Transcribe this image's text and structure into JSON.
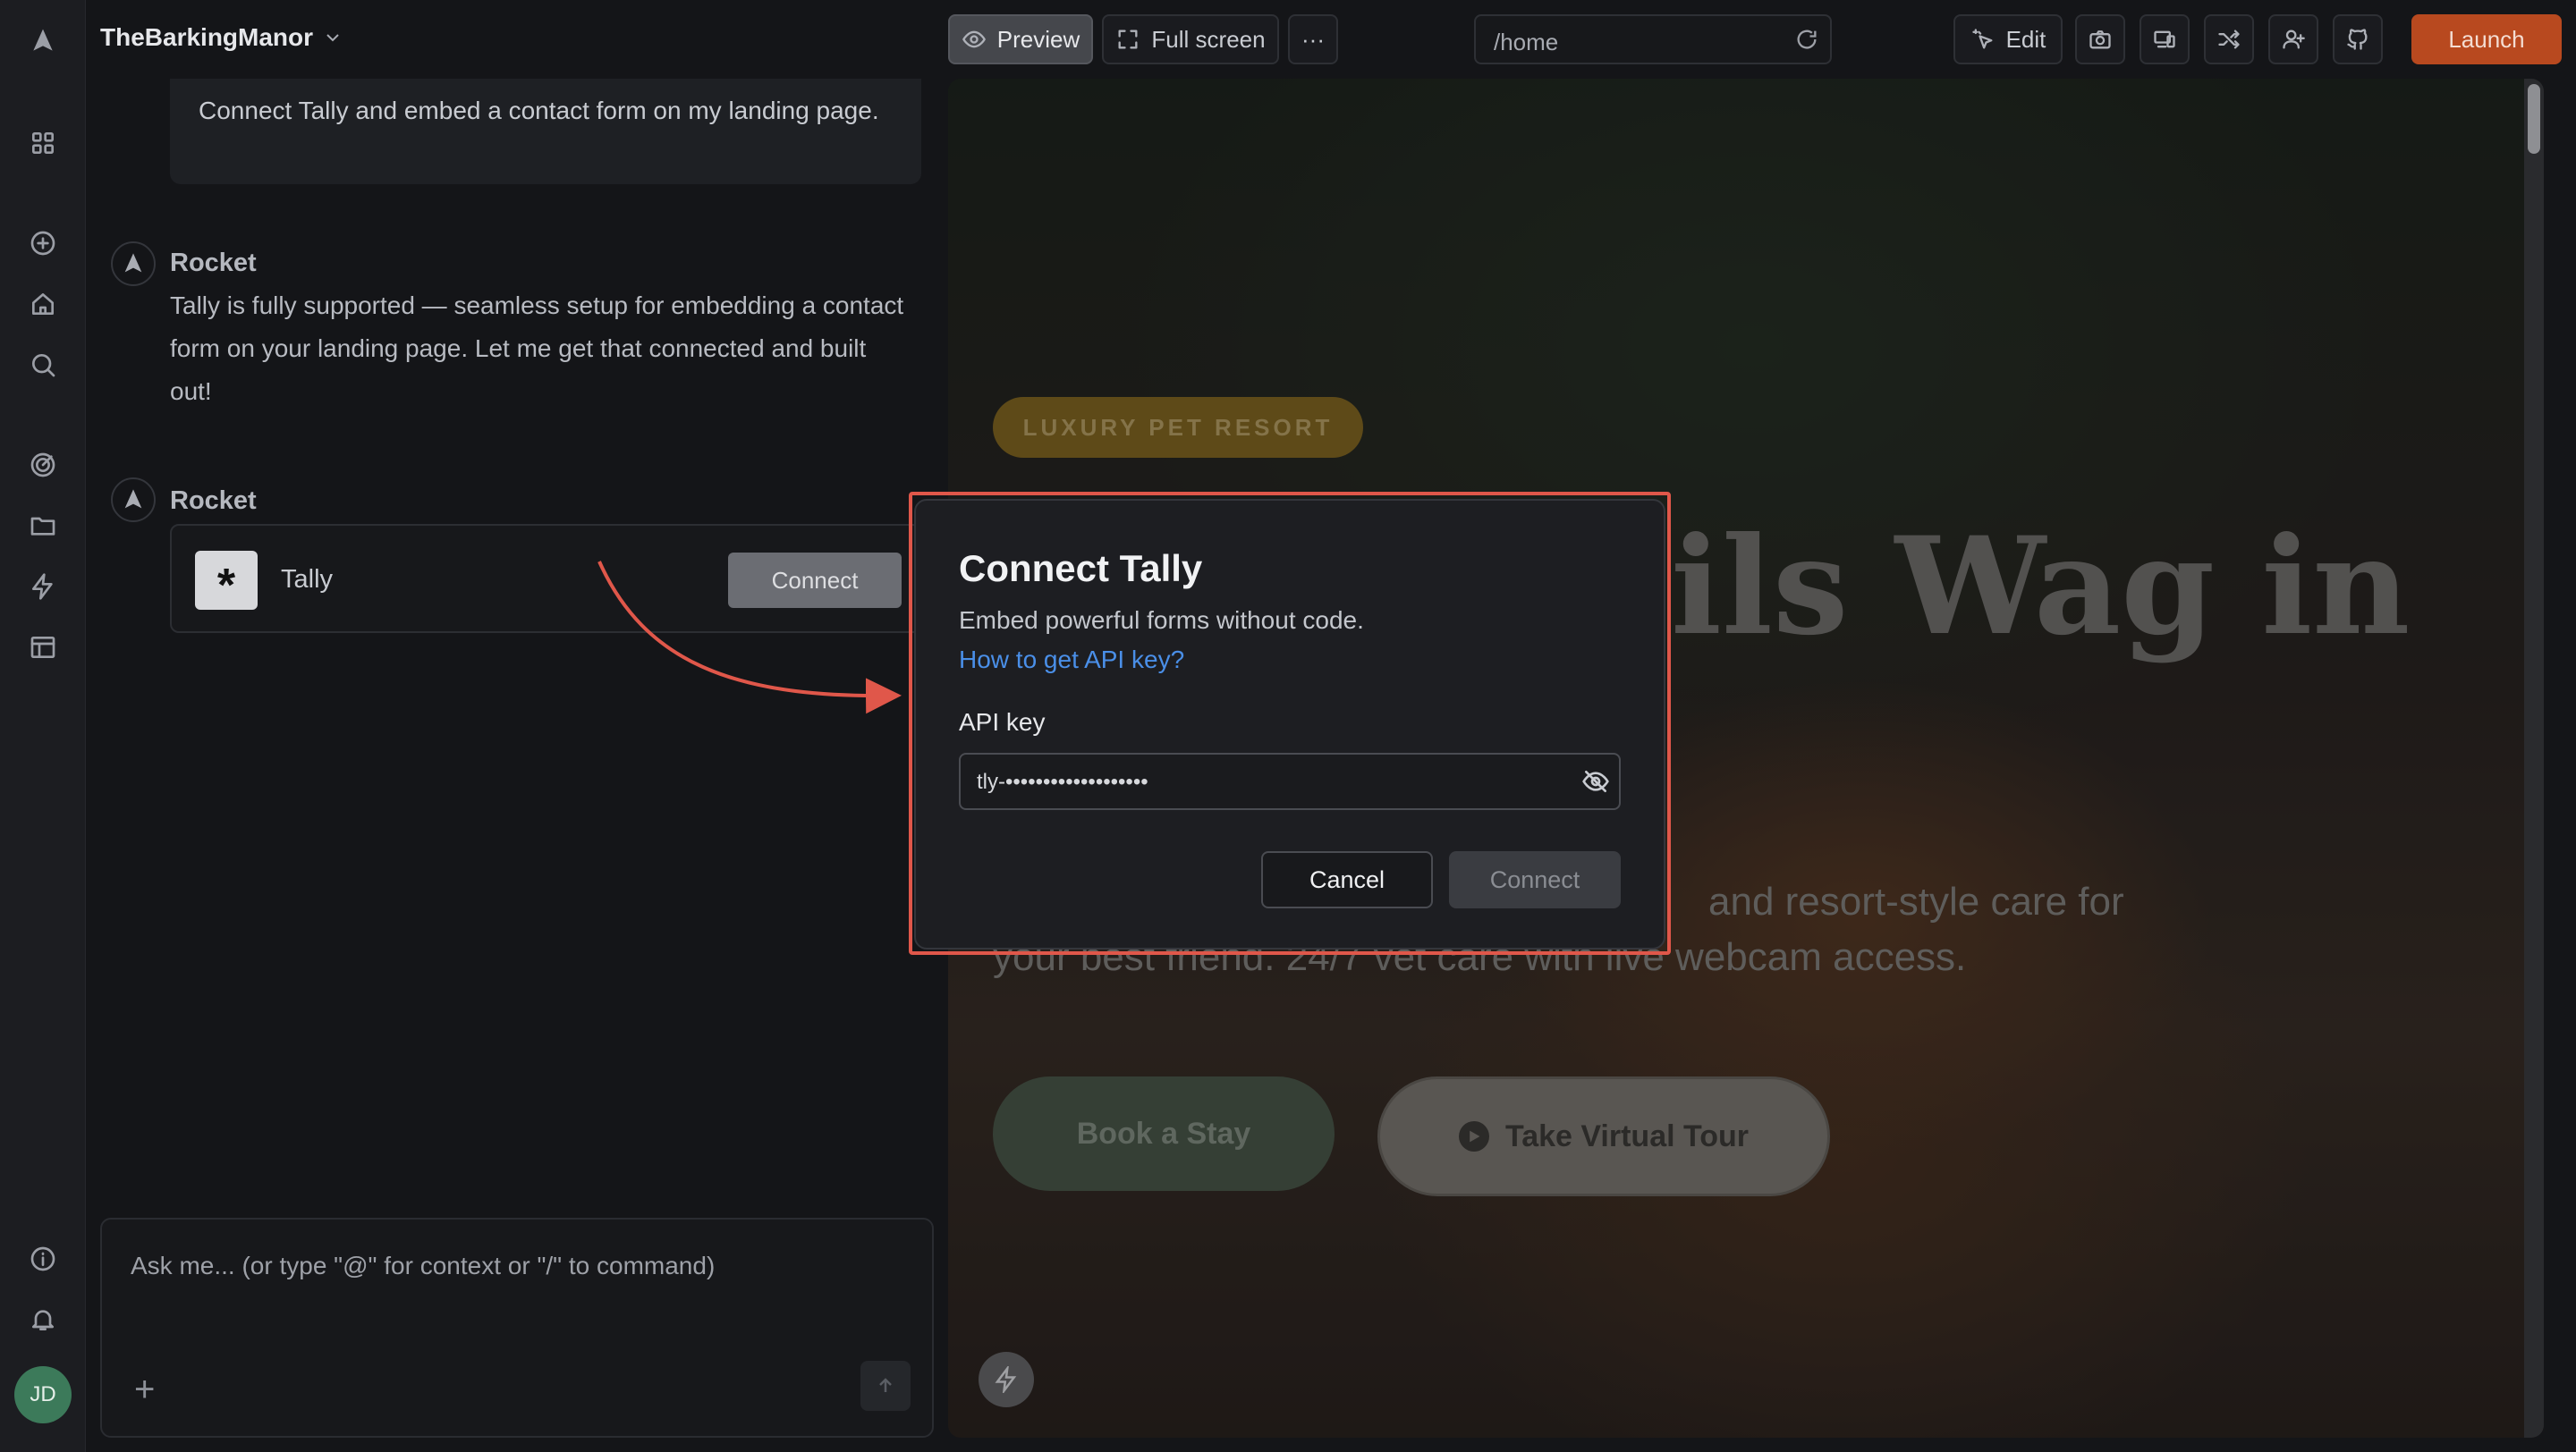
{
  "project": {
    "name": "TheBarkingManor"
  },
  "rail": {
    "icons": [
      "rocket-logo-icon",
      "grid-icon",
      "plus-circle-icon",
      "home-icon",
      "search-icon",
      "target-icon",
      "folder-icon",
      "lightning-icon",
      "layout-icon",
      "info-icon",
      "bell-icon"
    ],
    "avatar_initials": "JD"
  },
  "chat": {
    "user_message": "Connect Tally and embed a contact form on my landing page.",
    "messages": [
      {
        "sender": "Rocket",
        "text": "Tally is fully supported — seamless setup for embedding a contact form on your landing page. Let me get that connected and built out!"
      },
      {
        "sender": "Rocket"
      }
    ],
    "integration_card": {
      "name": "Tally",
      "logo_glyph": "*",
      "button_label": "Connect"
    },
    "composer": {
      "placeholder": "Ask me... (or type \"@\" for context or \"/\" to command)"
    }
  },
  "toolbar": {
    "preview_label": "Preview",
    "fullscreen_label": "Full screen",
    "more_label": "···",
    "url": "/home",
    "edit_label": "Edit",
    "launch_label": "Launch"
  },
  "preview_site": {
    "badge": "LUXURY PET RESORT",
    "hero_title_visible": "ils Wag in",
    "hero_subtitle_line1": "and resort-style care for",
    "hero_subtitle_line2": "your best friend. 24/7 vet care with live webcam access.",
    "primary_cta": "Book a Stay",
    "secondary_cta": "Take Virtual Tour"
  },
  "modal": {
    "title": "Connect Tally",
    "description": "Embed powerful forms without code.",
    "help_link": "How to get API key?",
    "api_key_label": "API key",
    "api_key_value": "tly-•••••••••••••••••••",
    "cancel_label": "Cancel",
    "connect_label": "Connect"
  },
  "colors": {
    "accent_launch": "#b8491f",
    "highlight_border": "#e0574a",
    "link": "#4a8fe8",
    "avatar": "#3c7a5a"
  }
}
